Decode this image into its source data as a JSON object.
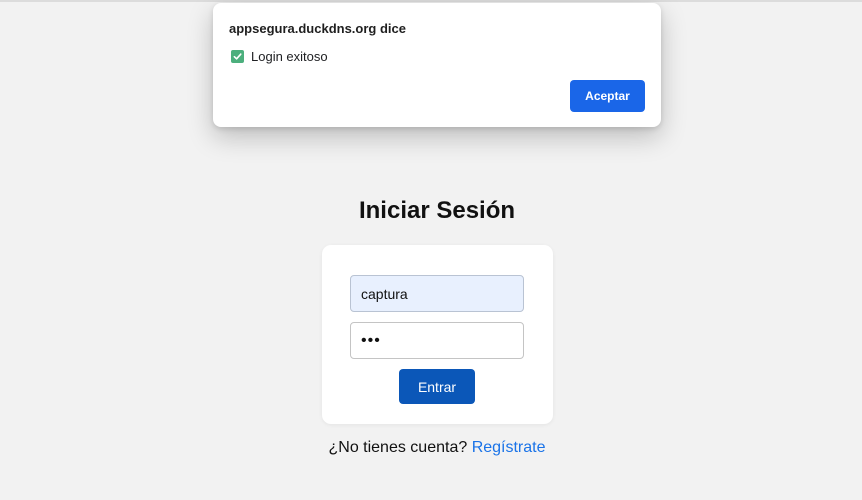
{
  "alert": {
    "origin": "appsegura.duckdns.org dice",
    "message_icon": "checkmark-icon",
    "message": "Login exitoso",
    "accept_label": "Aceptar"
  },
  "login": {
    "title": "Iniciar Sesión",
    "username_value": "captura",
    "password_value": "•••",
    "submit_label": "Entrar"
  },
  "footer": {
    "question": "¿No tienes cuenta?",
    "link_text": "Regístrate"
  },
  "colors": {
    "page_bg": "#f2f2f2",
    "accent_blue": "#1a66e8",
    "submit_blue": "#0b57b8",
    "link_blue": "#1a73e8",
    "success_green": "#4caf7d"
  }
}
